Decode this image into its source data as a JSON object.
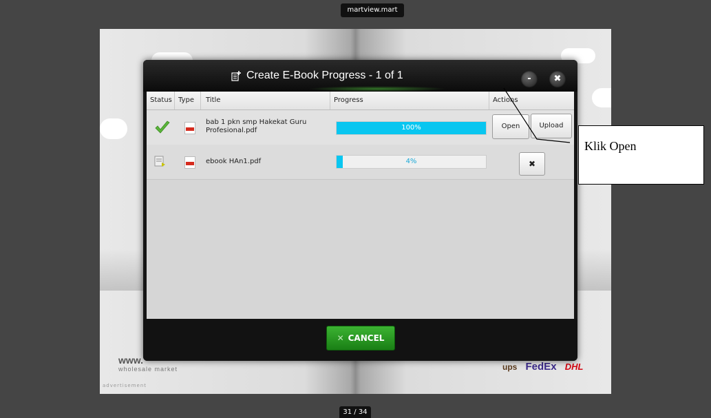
{
  "window": {
    "title": "martview.mart",
    "page_counter": "31 / 34"
  },
  "background": {
    "ad_logo": "www.",
    "ad_sub": "wholesale market",
    "ad_label": "advertisement",
    "carriers": {
      "ups": "ups",
      "fedex": "FedEx",
      "dhl": "DHL"
    }
  },
  "dialog": {
    "title": "Create E-Book Progress - 1 of 1",
    "header_buttons": {
      "minimize": "-",
      "close": "✖"
    },
    "columns": [
      "Status",
      "Type",
      "Title",
      "Progress",
      "Actions"
    ],
    "rows": [
      {
        "status": "done",
        "title_line1": "bab 1 pkn smp Hakekat Guru",
        "title_line2": "Profesional.pdf",
        "progress_percent": 100,
        "progress_label": "100%",
        "actions": [
          "Open",
          "Upload"
        ]
      },
      {
        "status": "pending",
        "title_line1": "ebook HAn1.pdf",
        "title_line2": "",
        "progress_percent": 4,
        "progress_label": "4%",
        "actions": [
          "✖"
        ]
      }
    ],
    "cancel_label": "CANCEL",
    "cancel_icon": "✕"
  },
  "annotation": {
    "text": "Klik Open"
  },
  "colors": {
    "progress": "#09c6f0",
    "cancel": "#2a9a22",
    "checkmark": "#5bb53a"
  }
}
